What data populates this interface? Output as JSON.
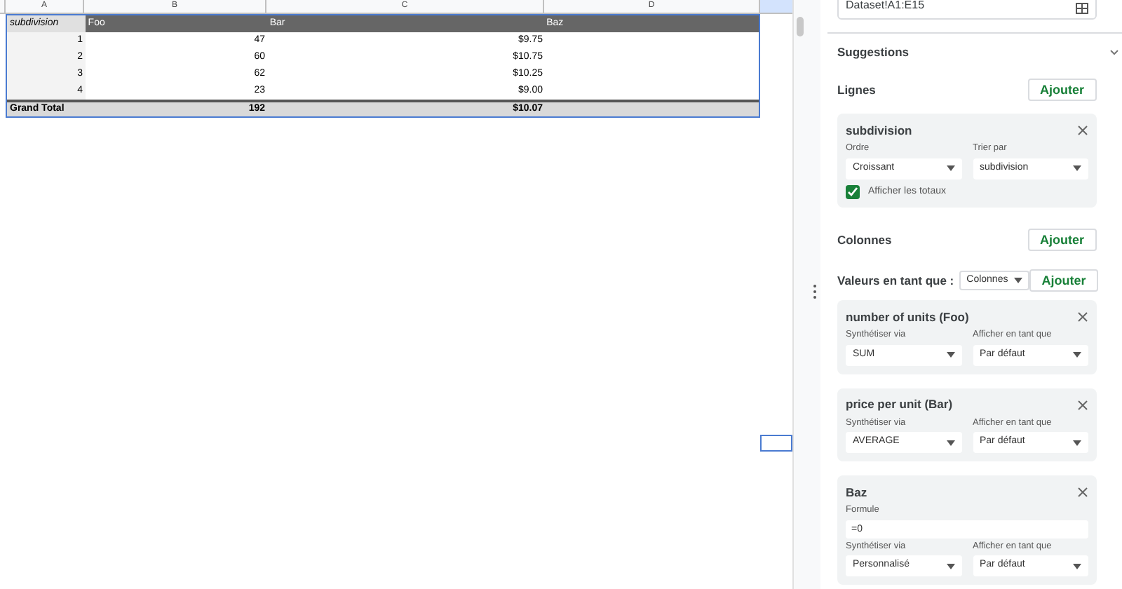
{
  "sheet": {
    "column_letters": [
      "A",
      "B",
      "C",
      "D"
    ],
    "pivot": {
      "header": {
        "row_label": "subdivision",
        "columns": [
          "Foo",
          "Bar",
          "Baz"
        ]
      },
      "rows": [
        {
          "label": "1",
          "values": [
            "47",
            "$9.75"
          ]
        },
        {
          "label": "2",
          "values": [
            "60",
            "$10.75"
          ]
        },
        {
          "label": "3",
          "values": [
            "62",
            "$10.25"
          ]
        },
        {
          "label": "4",
          "values": [
            "23",
            "$9.00"
          ]
        }
      ],
      "grand_total": {
        "label": "Grand Total",
        "values": [
          "192",
          "$10.07"
        ]
      }
    }
  },
  "panel": {
    "range": "Dataset!A1:E15",
    "suggestions": "Suggestions",
    "rows_section": {
      "title": "Lignes",
      "add": "Ajouter",
      "cards": [
        {
          "title": "subdivision",
          "fields": [
            {
              "label": "Ordre",
              "value": "Croissant"
            },
            {
              "label": "Trier par",
              "value": "subdivision"
            }
          ],
          "checkbox": {
            "label": "Afficher les totaux",
            "checked": true
          }
        }
      ]
    },
    "columns_section": {
      "title": "Colonnes",
      "add": "Ajouter"
    },
    "values_section": {
      "title": "Valeurs en tant que :",
      "select": "Colonnes",
      "add": "Ajouter",
      "cards": [
        {
          "title": "number of units (Foo)",
          "fields": [
            {
              "label": "Synthétiser via",
              "value": "SUM"
            },
            {
              "label": "Afficher en tant que",
              "value": "Par défaut"
            }
          ]
        },
        {
          "title": "price per unit (Bar)",
          "fields": [
            {
              "label": "Synthétiser via",
              "value": "AVERAGE"
            },
            {
              "label": "Afficher en tant que",
              "value": "Par défaut"
            }
          ]
        },
        {
          "title": "Baz",
          "formula": {
            "label": "Formule",
            "value": "=0"
          },
          "fields": [
            {
              "label": "Synthétiser via",
              "value": "Personnalisé"
            },
            {
              "label": "Afficher en tant que",
              "value": "Par défaut"
            }
          ]
        }
      ]
    }
  }
}
